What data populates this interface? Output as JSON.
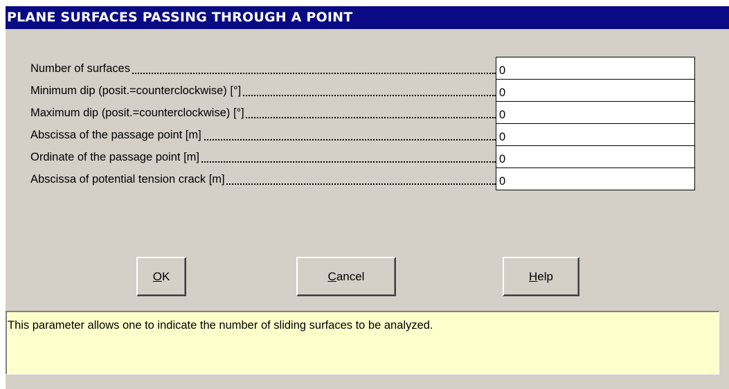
{
  "dialog": {
    "title": "PLANE SURFACES PASSING THROUGH A POINT"
  },
  "fields": [
    {
      "label": "Number of surfaces",
      "value": "0"
    },
    {
      "label": "Minimum dip (posit.=counterclockwise) [°]",
      "value": "0"
    },
    {
      "label": "Maximum dip (posit.=counterclockwise) [°]",
      "value": "0"
    },
    {
      "label": "Abscissa of the passage point [m]",
      "value": "0"
    },
    {
      "label": "Ordinate of the passage point [m]",
      "value": "0"
    },
    {
      "label": "Abscissa of potential tension crack [m]",
      "value": "0"
    }
  ],
  "buttons": {
    "ok": {
      "mnemonic": "O",
      "rest": "K"
    },
    "cancel": {
      "mnemonic": "C",
      "rest": "ancel"
    },
    "help": {
      "mnemonic": "H",
      "rest": "elp"
    }
  },
  "info": {
    "text": "This parameter allows one to indicate the number of sliding surfaces to be analyzed."
  },
  "colors": {
    "title_bar": "#0a0a84",
    "dialog_bg": "#d4d0c8",
    "info_bg": "#ffffcc"
  }
}
